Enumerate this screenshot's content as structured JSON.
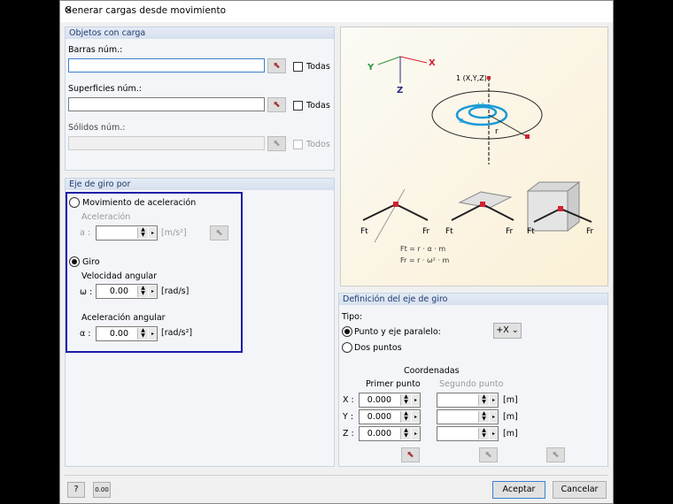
{
  "title": "Generar cargas desde movimiento",
  "objects": {
    "header": "Objetos con carga",
    "bars_label": "Barras núm.:",
    "bars_value": "",
    "bars_all": "Todas",
    "surfaces_label": "Superficies núm.:",
    "surfaces_value": "",
    "surfaces_all": "Todas",
    "solids_label": "Sólidos núm.:",
    "solids_value": "",
    "solids_all": "Todos"
  },
  "axis": {
    "header": "Eje de giro por",
    "accel_motion": "Movimiento de aceleración",
    "accel_label": "Aceleración",
    "a_symbol": "a :",
    "a_unit": "[m/s²]",
    "rotation": "Giro",
    "ang_vel_label": "Velocidad angular",
    "omega_symbol": "ω :",
    "omega_value": "0.00",
    "omega_unit": "[rad/s]",
    "ang_acc_label": "Aceleración angular",
    "alpha_symbol": "α :",
    "alpha_value": "0.00",
    "alpha_unit": "[rad/s²]"
  },
  "diagram": {
    "x": "X",
    "y": "Y",
    "z": "Z",
    "point": "1 (X,Y,Z)",
    "omega": "ω",
    "alpha": "α",
    "r": "r",
    "ft": "Ft",
    "fr": "Fr",
    "eq1": "Ft = r · α · m",
    "eq2": "Fr = r · ω² · m"
  },
  "definition": {
    "header": "Definición del eje de giro",
    "type_label": "Tipo:",
    "point_axis": "Punto y eje paralelo:",
    "axis_dir": "+X",
    "two_points": "Dos puntos",
    "coords": "Coordenadas",
    "first": "Primer punto",
    "second": "Segundo punto",
    "rows": [
      {
        "label": "X :",
        "value": "0.000",
        "unit": "[m]"
      },
      {
        "label": "Y :",
        "value": "0.000",
        "unit": "[m]"
      },
      {
        "label": "Z :",
        "value": "0.000",
        "unit": "[m]"
      }
    ]
  },
  "footer": {
    "ok": "Aceptar",
    "cancel": "Cancelar",
    "units_icon": "0.00"
  },
  "colors": {
    "highlight": "#1a1aa8",
    "accent": "#d42030",
    "blue_arrow": "#1a9ad6"
  }
}
